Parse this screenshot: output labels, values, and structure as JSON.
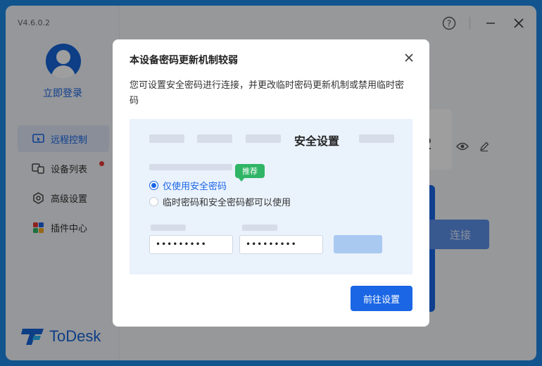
{
  "app": {
    "version": "V4.6.0.2",
    "login_label": "立即登录",
    "logo_text": "ToDesk"
  },
  "sidebar": {
    "items": [
      {
        "label": "远程控制",
        "icon": "remote-control-icon",
        "active": true
      },
      {
        "label": "设备列表",
        "icon": "device-list-icon",
        "active": false,
        "badge": true
      },
      {
        "label": "高级设置",
        "icon": "settings-icon",
        "active": false
      },
      {
        "label": "插件中心",
        "icon": "plugin-icon",
        "active": false
      }
    ]
  },
  "titlebar": {
    "icons": [
      "help-icon",
      "minimize-icon",
      "close-icon"
    ]
  },
  "main": {
    "partial_digit": "2",
    "connect_label": "连接"
  },
  "dialog": {
    "title": "本设备密码更新机制较弱",
    "description": "您可设置安全密码进行连接，并更改临时密码更新机制或禁用临时密码",
    "preview": {
      "title": "安全设置",
      "badge": "推荐",
      "option_1": "仅使用安全密码",
      "option_2": "临时密码和安全密码都可以使用",
      "password_1": "•••••••••",
      "password_2": "•••••••••"
    },
    "go_button": "前往设置"
  },
  "colors": {
    "accent": "#1a66e5",
    "recommend_green": "#2fb565",
    "backdrop": "#1e88e5"
  }
}
